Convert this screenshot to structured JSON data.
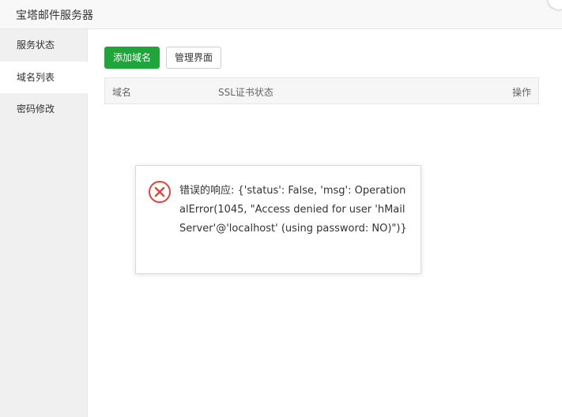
{
  "window": {
    "title": "宝塔邮件服务器"
  },
  "sidebar": {
    "items": [
      {
        "label": "服务状态"
      },
      {
        "label": "域名列表"
      },
      {
        "label": "密码修改"
      }
    ]
  },
  "toolbar": {
    "add_domain_label": "添加域名",
    "manage_ui_label": "管理界面"
  },
  "table": {
    "columns": [
      "域名",
      "SSL证书状态",
      "操作"
    ],
    "rows": []
  },
  "error_dialog": {
    "icon": "error-circle-x-icon",
    "message": "错误的响应: {'status': False, 'msg': OperationalError(1045, \"Access denied for user 'hMailServer'@'localhost' (using password: NO)\")}"
  },
  "colors": {
    "primary": "#20a53a",
    "error": "#e0463a"
  }
}
